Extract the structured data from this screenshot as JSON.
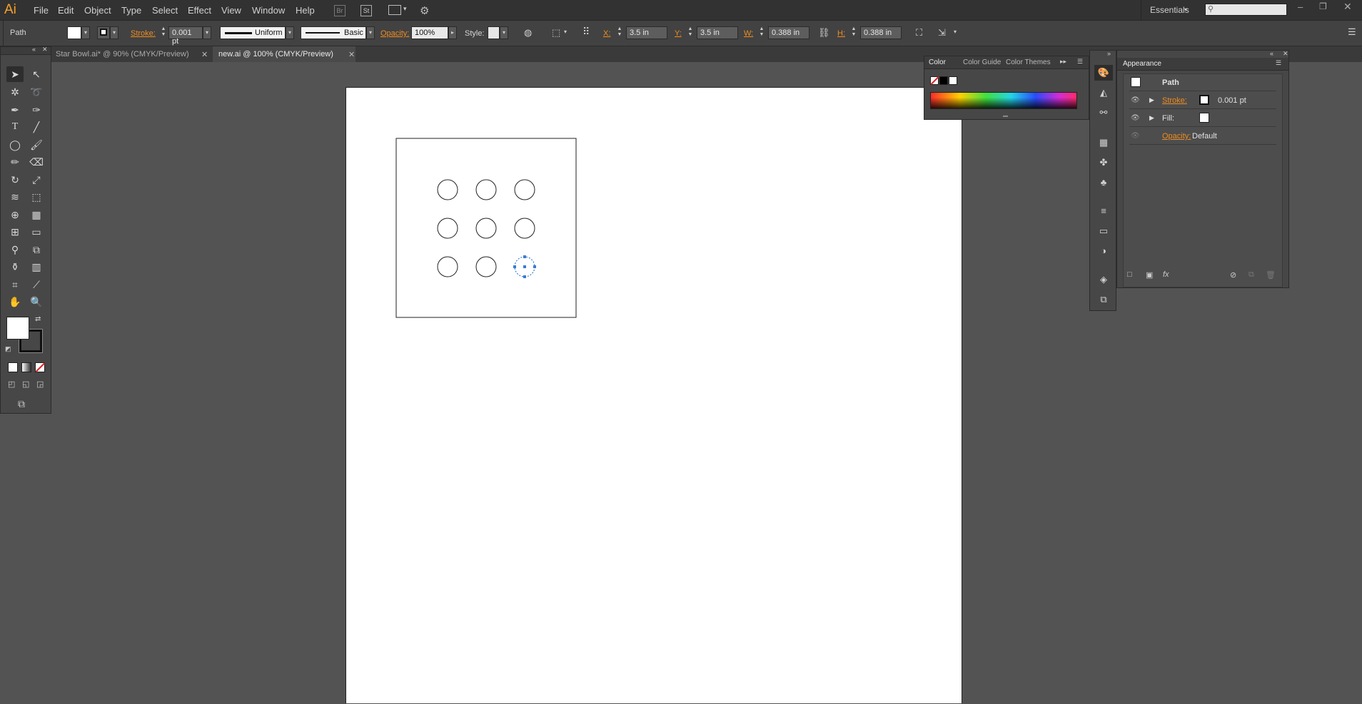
{
  "app": {
    "logo": "Ai"
  },
  "menu": [
    "File",
    "Edit",
    "Object",
    "Type",
    "Select",
    "Effect",
    "View",
    "Window",
    "Help"
  ],
  "menu_right": {
    "br_label": "Br",
    "st_label": "St",
    "workspace": "Essentials"
  },
  "control": {
    "selection_type": "Path",
    "stroke_label": "Stroke:",
    "stroke_value": "0.001 pt",
    "stroke_profile": "Uniform",
    "brush": "Basic",
    "opacity_label": "Opacity:",
    "opacity_value": "100%",
    "style_label": "Style:",
    "x_label": "X:",
    "x_value": "3.5 in",
    "y_label": "Y:",
    "y_value": "3.5 in",
    "w_label": "W:",
    "w_value": "0.388 in",
    "h_label": "H:",
    "h_value": "0.388 in"
  },
  "tabs": [
    {
      "label": "Star Bowl.ai* @ 90% (CMYK/Preview)",
      "active": false
    },
    {
      "label": "new.ai @ 100% (CMYK/Preview)",
      "active": true
    }
  ],
  "color_panel": {
    "tabs": [
      "Color",
      "Color Guide",
      "Color Themes"
    ]
  },
  "appearance_panel": {
    "title": "Appearance",
    "object": "Path",
    "rows": [
      {
        "label": "Stroke:",
        "value": "0.001 pt"
      },
      {
        "label": "Fill:",
        "value": ""
      },
      {
        "label": "Opacity:",
        "value": "Default"
      }
    ]
  },
  "colors": {
    "accent": "#f08c1e",
    "selection": "#3a7bd5",
    "canvas_bg": "#535353"
  }
}
